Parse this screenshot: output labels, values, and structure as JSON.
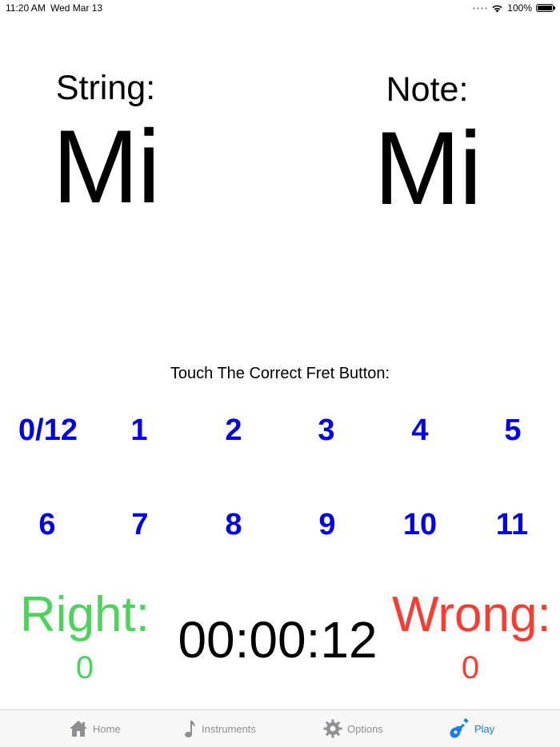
{
  "status_bar": {
    "time": "11:20 AM",
    "date": "Wed Mar 13",
    "battery": "100%",
    "battery_level": 1.0
  },
  "string_block": {
    "title": "String:",
    "value": "Mi"
  },
  "note_block": {
    "title": "Note:",
    "value": "Mi"
  },
  "instruction": "Touch The Correct Fret Button:",
  "frets": {
    "row1": [
      "0/12",
      "1",
      "2",
      "3",
      "4",
      "5"
    ],
    "row2": [
      "6",
      "7",
      "8",
      "9",
      "10",
      "11"
    ],
    "color": "#0000ee"
  },
  "score": {
    "right_label": "Right:",
    "right_count": "0",
    "right_color": "#4cd45a",
    "wrong_label": "Wrong:",
    "wrong_count": "0",
    "wrong_color": "#ff3b30"
  },
  "timer": "00:00:12",
  "tab_bar": {
    "tabs": [
      {
        "label": "Home",
        "icon": "home-icon",
        "active": false
      },
      {
        "label": "Instruments",
        "icon": "music-note-icon",
        "active": false
      },
      {
        "label": "Options",
        "icon": "gear-icon",
        "active": false
      },
      {
        "label": "Play",
        "icon": "guitar-icon",
        "active": true
      }
    ],
    "active_color": "#1a7cf5",
    "inactive_color": "#8e8e93"
  }
}
